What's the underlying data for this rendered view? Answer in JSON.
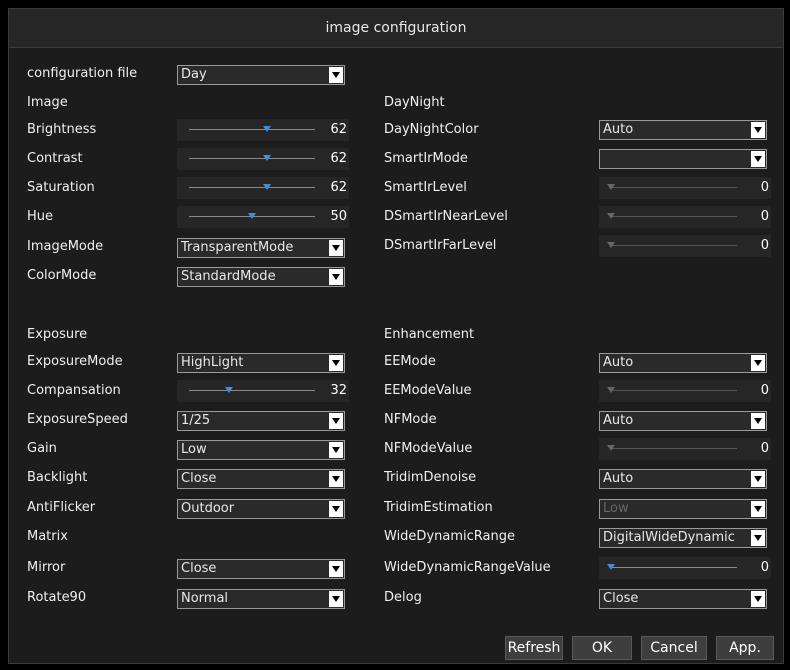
{
  "window": {
    "title": "image configuration"
  },
  "config_file": {
    "label": "configuration file",
    "value": "Day"
  },
  "image": {
    "header": "Image",
    "brightness": {
      "label": "Brightness",
      "value": 62,
      "fraction": 0.62
    },
    "contrast": {
      "label": "Contrast",
      "value": 62,
      "fraction": 0.62
    },
    "saturation": {
      "label": "Saturation",
      "value": 62,
      "fraction": 0.62
    },
    "hue": {
      "label": "Hue",
      "value": 50,
      "fraction": 0.5
    },
    "image_mode": {
      "label": "ImageMode",
      "value": "TransparentMode"
    },
    "color_mode": {
      "label": "ColorMode",
      "value": "StandardMode"
    }
  },
  "daynight": {
    "header": "DayNight",
    "color": {
      "label": "DayNightColor",
      "value": "Auto"
    },
    "smart_ir_mode": {
      "label": "SmartIrMode",
      "value": ""
    },
    "smart_ir_level": {
      "label": "SmartIrLevel",
      "value": 0,
      "fraction": 0
    },
    "ds_near": {
      "label": "DSmartIrNearLevel",
      "value": 0,
      "fraction": 0
    },
    "ds_far": {
      "label": "DSmartIrFarLevel",
      "value": 0,
      "fraction": 0
    }
  },
  "exposure": {
    "header": "Exposure",
    "mode": {
      "label": "ExposureMode",
      "value": "HighLight"
    },
    "compensation": {
      "label": "Compansation",
      "value": 32,
      "fraction": 0.32
    },
    "speed": {
      "label": "ExposureSpeed",
      "value": "1/25"
    },
    "gain": {
      "label": "Gain",
      "value": "Low"
    },
    "backlight": {
      "label": "Backlight",
      "value": "Close"
    },
    "antiflicker": {
      "label": "AntiFlicker",
      "value": "Outdoor"
    },
    "matrix": {
      "label": "Matrix"
    },
    "mirror": {
      "label": "Mirror",
      "value": "Close"
    },
    "rotate90": {
      "label": "Rotate90",
      "value": "Normal"
    }
  },
  "enhancement": {
    "header": "Enhancement",
    "ee_mode": {
      "label": "EEMode",
      "value": "Auto"
    },
    "ee_mode_value": {
      "label": "EEModeValue",
      "value": 0,
      "fraction": 0
    },
    "nf_mode": {
      "label": "NFMode",
      "value": "Auto"
    },
    "nf_mode_value": {
      "label": "NFModeValue",
      "value": 0,
      "fraction": 0
    },
    "tridim_denoise": {
      "label": "TridimDenoise",
      "value": "Auto"
    },
    "tridim_estimation": {
      "label": "TridimEstimation",
      "value": "Low"
    },
    "wdr": {
      "label": "WideDynamicRange",
      "value": "DigitalWideDynamic"
    },
    "wdr_value": {
      "label": "WideDynamicRangeValue",
      "value": 0,
      "fraction": 0
    },
    "delog": {
      "label": "Delog",
      "value": "Close"
    }
  },
  "buttons": {
    "refresh": "Refresh",
    "ok": "OK",
    "cancel": "Cancel",
    "apply": "App."
  },
  "colors": {
    "slider_knob": "#3a8fe0",
    "background": "#1c1c1c"
  }
}
